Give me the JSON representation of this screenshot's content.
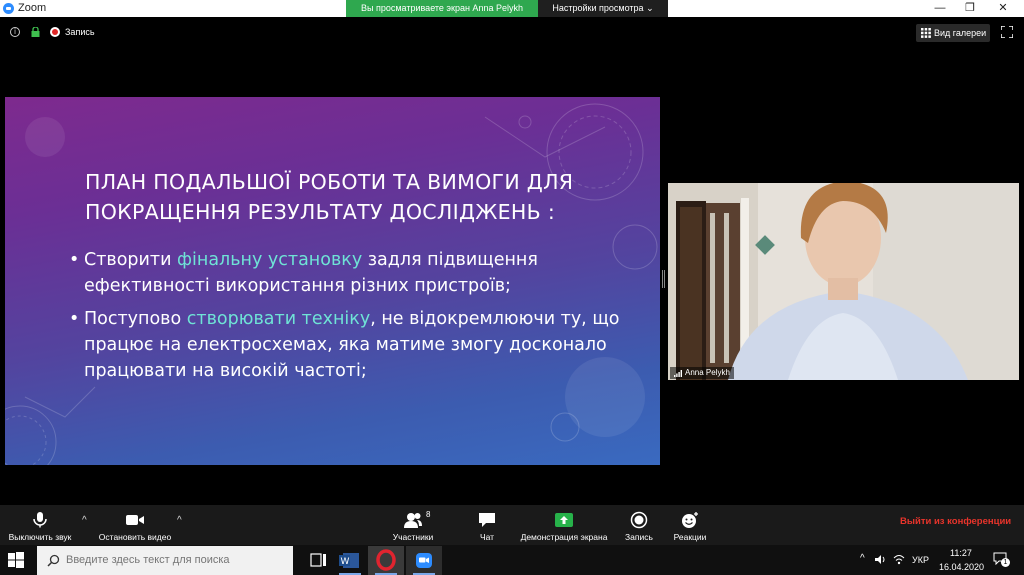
{
  "window": {
    "app_title": "Zoom",
    "share_banner": "Вы просматриваете экран Anna Pelykh",
    "view_settings": "Настройки просмотра",
    "view_settings_caret": "⌄",
    "minimize": "—",
    "restore": "❐",
    "close": "✕"
  },
  "infobar": {
    "info_glyph": "i",
    "recording_label": "Запись",
    "gallery_view": "Вид галереи"
  },
  "slide": {
    "title_line1": "План подальшої роботи та вимоги для",
    "title_line2": "покращення результату досліджень :",
    "bullet_glyph": "•",
    "bullet1": {
      "pre": "Створити ",
      "highlight": "фінальну установку",
      "post": " задля підвищення ефективності використання різних пристроїв;"
    },
    "bullet2": {
      "pre": "Поступово ",
      "highlight": "створювати техніку",
      "post": ", не відокремлюючи ту, що працює на електросхемах, яка матиме змогу досконало працювати на високій частоті;"
    },
    "colors": {
      "bg_top": "#7e2a8e",
      "bg_bottom": "#3a6ac0",
      "highlight": "#6fe3d6"
    }
  },
  "video": {
    "participant_name": "Anna Pelykh"
  },
  "toolbar": {
    "mute": "Выключить звук",
    "stop_video": "Остановить видео",
    "participants": "Участники",
    "participants_count": "8",
    "chat": "Чат",
    "share_screen": "Демонстрация экрана",
    "record": "Запись",
    "reactions": "Реакции",
    "leave": "Выйти из конференции",
    "caret": "^"
  },
  "taskbar": {
    "search_placeholder": "Введите здесь текст для поиска",
    "language": "УКР",
    "time": "11:27",
    "date": "16.04.2020",
    "notification_count": "1",
    "tray_caret": "^"
  }
}
